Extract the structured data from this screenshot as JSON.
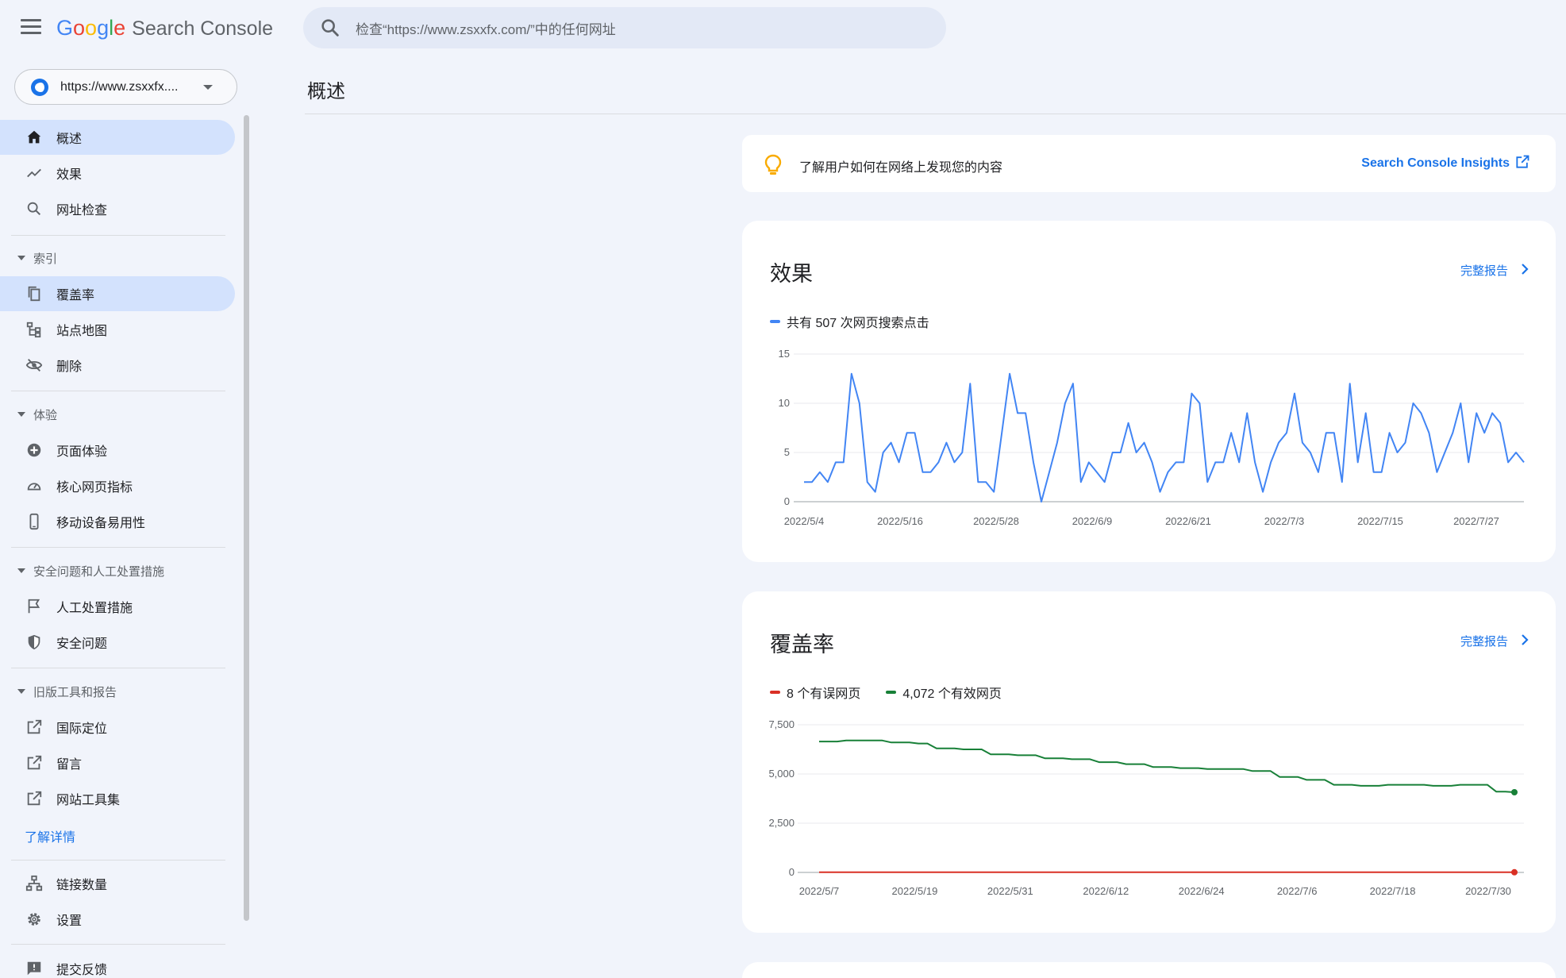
{
  "header": {
    "logo_google": [
      "G",
      "o",
      "o",
      "g",
      "l",
      "e"
    ],
    "logo_product": "Search Console",
    "search_placeholder": "检查“https://www.zsxxfx.com/”中的任何网址"
  },
  "property": {
    "url": "https://www.zsxxfx...."
  },
  "sidebar": {
    "top_items": [
      {
        "label": "概述",
        "icon": "home-icon",
        "active": true
      },
      {
        "label": "效果",
        "icon": "trending-icon",
        "active": false
      },
      {
        "label": "网址检查",
        "icon": "search-icon",
        "active": false
      }
    ],
    "sections": [
      {
        "title": "索引",
        "items": [
          {
            "label": "覆盖率",
            "icon": "pages-icon",
            "active": true
          },
          {
            "label": "站点地图",
            "icon": "sitemap-icon",
            "active": false
          },
          {
            "label": "删除",
            "icon": "eye-off-icon",
            "active": false
          }
        ]
      },
      {
        "title": "体验",
        "items": [
          {
            "label": "页面体验",
            "icon": "plus-circle-icon",
            "active": false
          },
          {
            "label": "核心网页指标",
            "icon": "speedometer-icon",
            "active": false
          },
          {
            "label": "移动设备易用性",
            "icon": "phone-icon",
            "active": false
          }
        ]
      },
      {
        "title": "安全问题和人工处置措施",
        "items": [
          {
            "label": "人工处置措施",
            "icon": "flag-icon",
            "active": false
          },
          {
            "label": "安全问题",
            "icon": "shield-icon",
            "active": false
          }
        ]
      },
      {
        "title": "旧版工具和报告",
        "items": [
          {
            "label": "国际定位",
            "icon": "external-link-icon",
            "active": false
          },
          {
            "label": "留言",
            "icon": "external-link-icon",
            "active": false
          },
          {
            "label": "网站工具集",
            "icon": "external-link-icon",
            "active": false
          }
        ]
      }
    ],
    "learn_more": "了解详情",
    "bottom_items": [
      {
        "label": "链接数量",
        "icon": "network-icon"
      },
      {
        "label": "设置",
        "icon": "gear-icon"
      },
      {
        "label": "提交反馈",
        "icon": "feedback-icon"
      }
    ]
  },
  "main": {
    "page_title": "概述",
    "insights": {
      "text": "了解用户如何在网络上发现您的内容",
      "link": "Search Console Insights"
    },
    "performance": {
      "title": "效果",
      "full_report": "完整报告",
      "legend": "共有 507 次网页搜索点击"
    },
    "coverage": {
      "title": "覆盖率",
      "full_report": "完整报告",
      "legend_error": "8 个有误网页",
      "legend_valid": "4,072 个有效网页"
    }
  },
  "colors": {
    "accent": "#1a73e8",
    "clicks": "#4285f4",
    "error": "#d93025",
    "valid": "#188038",
    "active_bg": "#d3e2fd"
  },
  "chart_data": [
    {
      "type": "line",
      "title": "效果",
      "ylim": [
        0,
        15
      ],
      "yticks": [
        "0",
        "5",
        "10",
        "15"
      ],
      "xticks": [
        "2022/5/4",
        "2022/5/16",
        "2022/5/28",
        "2022/6/9",
        "2022/6/21",
        "2022/7/3",
        "2022/7/15",
        "2022/7/27"
      ],
      "x_start": "2022/5/4",
      "x_end": "2022/8/1",
      "series": [
        {
          "name": "共有 507 次网页搜索点击",
          "color": "#4285f4",
          "values": [
            2,
            2,
            3,
            2,
            4,
            4,
            13,
            10,
            2,
            1,
            5,
            6,
            4,
            7,
            7,
            3,
            3,
            4,
            6,
            4,
            5,
            12,
            2,
            2,
            1,
            7,
            13,
            9,
            9,
            4,
            0,
            3,
            6,
            10,
            12,
            2,
            4,
            3,
            2,
            5,
            5,
            8,
            5,
            6,
            4,
            1,
            3,
            4,
            4,
            11,
            10,
            2,
            4,
            4,
            7,
            4,
            9,
            4,
            1,
            4,
            6,
            7,
            11,
            6,
            5,
            3,
            7,
            7,
            2,
            12,
            4,
            9,
            3,
            3,
            7,
            5,
            6,
            10,
            9,
            7,
            3,
            5,
            7,
            10,
            4,
            9,
            7,
            9,
            8,
            4,
            5,
            4
          ]
        }
      ],
      "grid": true
    },
    {
      "type": "line",
      "title": "覆盖率",
      "ylim": [
        0,
        7500
      ],
      "yticks": [
        "0",
        "2,500",
        "5,000",
        "7,500"
      ],
      "xticks": [
        "2022/5/7",
        "2022/5/19",
        "2022/5/31",
        "2022/6/12",
        "2022/6/24",
        "2022/7/6",
        "2022/7/18",
        "2022/7/30"
      ],
      "x_start": "2022/5/7",
      "x_end": "2022/8/1",
      "series": [
        {
          "name": "4,072 个有效网页",
          "color": "#188038",
          "values": [
            6650,
            6650,
            6650,
            6700,
            6700,
            6700,
            6700,
            6700,
            6600,
            6600,
            6600,
            6550,
            6550,
            6300,
            6300,
            6300,
            6250,
            6250,
            6250,
            6000,
            6000,
            6000,
            5950,
            5950,
            5950,
            5800,
            5800,
            5800,
            5750,
            5750,
            5750,
            5600,
            5600,
            5600,
            5500,
            5500,
            5500,
            5350,
            5350,
            5350,
            5300,
            5300,
            5300,
            5250,
            5250,
            5250,
            5250,
            5250,
            5150,
            5150,
            5150,
            4850,
            4850,
            4850,
            4700,
            4700,
            4700,
            4450,
            4450,
            4450,
            4400,
            4400,
            4400,
            4450,
            4450,
            4450,
            4450,
            4450,
            4400,
            4400,
            4400,
            4450,
            4450,
            4450,
            4450,
            4100,
            4100,
            4072
          ]
        },
        {
          "name": "8 个有误网页",
          "color": "#d93025",
          "values": [
            10,
            10,
            10,
            10,
            10,
            10,
            10,
            10,
            10,
            10,
            10,
            10,
            10,
            10,
            10,
            10,
            10,
            10,
            10,
            10,
            10,
            10,
            10,
            10,
            10,
            10,
            10,
            10,
            10,
            10,
            10,
            10,
            10,
            10,
            10,
            10,
            10,
            10,
            10,
            10,
            10,
            10,
            10,
            10,
            10,
            10,
            10,
            10,
            10,
            10,
            10,
            10,
            10,
            10,
            10,
            10,
            10,
            10,
            10,
            10,
            10,
            10,
            10,
            10,
            10,
            10,
            10,
            10,
            10,
            10,
            10,
            10,
            10,
            10,
            10,
            10,
            10,
            8
          ]
        }
      ],
      "grid": true
    }
  ]
}
